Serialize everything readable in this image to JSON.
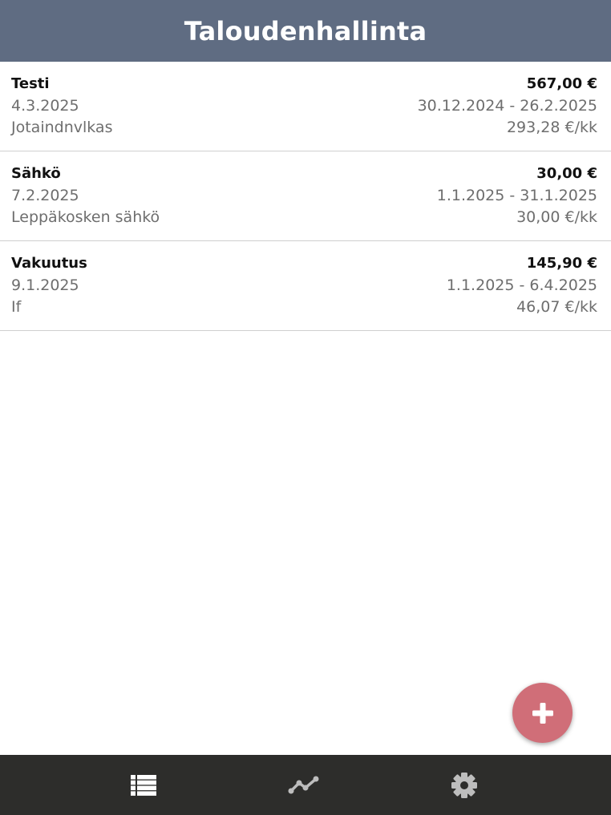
{
  "header": {
    "title": "Taloudenhallinta"
  },
  "bills": [
    {
      "name": "Testi",
      "amount": "567,00 €",
      "date": "4.3.2025",
      "period": "30.12.2024 - 26.2.2025",
      "payee": "Jotaindnvlkas",
      "monthly": "293,28 €/kk"
    },
    {
      "name": "Sähkö",
      "amount": "30,00 €",
      "date": "7.2.2025",
      "period": "1.1.2025 - 31.1.2025",
      "payee": "Leppäkosken sähkö",
      "monthly": "30,00 €/kk"
    },
    {
      "name": "Vakuutus",
      "amount": "145,90 €",
      "date": "9.1.2025",
      "period": "1.1.2025 - 6.4.2025",
      "payee": "If",
      "monthly": "46,07 €/kk"
    }
  ],
  "fab": {
    "icon": "plus-icon"
  },
  "nav": {
    "items": [
      {
        "icon": "list-icon",
        "active": true
      },
      {
        "icon": "trend-chart-icon",
        "active": false
      },
      {
        "icon": "gear-icon",
        "active": false
      }
    ]
  },
  "colors": {
    "header_bg": "#5f6c82",
    "fab_bg": "#d06e78",
    "nav_bg": "#2d2d2b",
    "nav_active": "#ffffff",
    "nav_inactive": "#bdbdbd"
  }
}
